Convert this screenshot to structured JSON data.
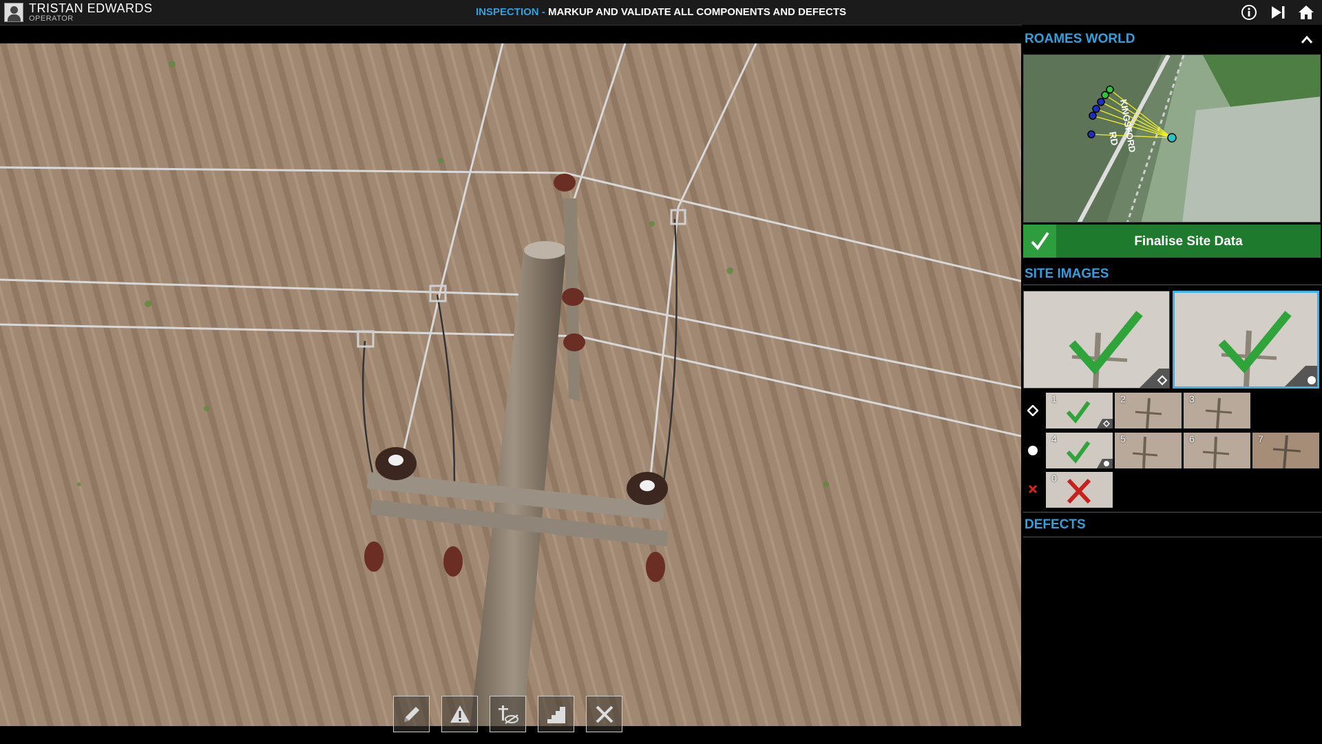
{
  "user": {
    "name": "TRISTAN EDWARDS",
    "role": "OPERATOR"
  },
  "header": {
    "mode": "INSPECTION",
    "separator": " - ",
    "instruction": "MARKUP AND VALIDATE ALL COMPONENTS AND DEFECTS"
  },
  "header_icons": [
    "info-icon",
    "skip-next-icon",
    "home-icon"
  ],
  "roames_world": {
    "title": "ROAMES WORLD",
    "road_label": "RD",
    "road_name": "KINGSFORD"
  },
  "finalise": {
    "label": "Finalise Site Data"
  },
  "site_images": {
    "title": "SITE IMAGES",
    "selected": [
      {
        "marker": "diamond",
        "status": "approved"
      },
      {
        "marker": "circle",
        "status": "approved",
        "highlighted": true
      }
    ],
    "rows": [
      {
        "marker": "diamond",
        "thumbs": [
          {
            "num": "1",
            "status": "approved"
          },
          {
            "num": "2"
          },
          {
            "num": "3"
          }
        ]
      },
      {
        "marker": "circle",
        "thumbs": [
          {
            "num": "4",
            "status": "approved"
          },
          {
            "num": "5"
          },
          {
            "num": "6"
          },
          {
            "num": "7"
          }
        ]
      },
      {
        "marker": "cross",
        "thumbs": [
          {
            "num": "0",
            "status": "rejected"
          }
        ]
      }
    ]
  },
  "defects": {
    "title": "DEFECTS"
  },
  "tools": [
    "pencil-icon",
    "warning-icon",
    "pole-hidden-icon",
    "stairs-icon",
    "close-icon"
  ],
  "colors": {
    "accent": "#2fa0e0",
    "finalise_green": "#1e7a2c",
    "approved_green": "#2ea43a",
    "rejected_red": "#c8201e"
  }
}
